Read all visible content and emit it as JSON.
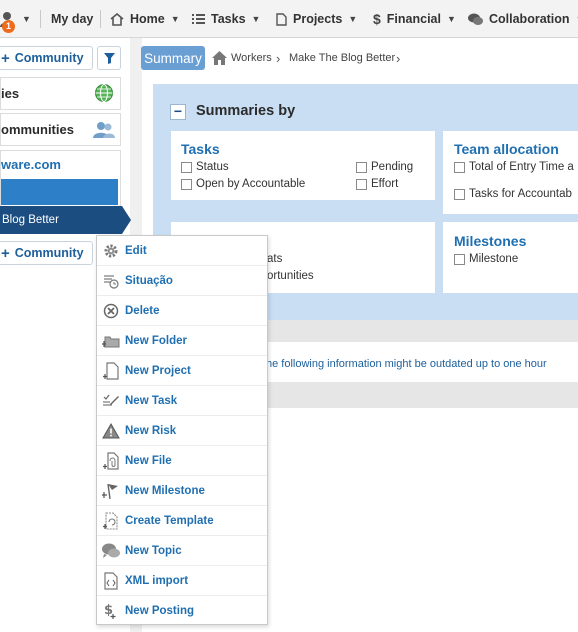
{
  "topnav": {
    "notification_count": "1",
    "my_day": "My day",
    "home": "Home",
    "tasks": "Tasks",
    "projects": "Projects",
    "financial": "Financial",
    "collaboration": "Collaboration"
  },
  "left_panel": {
    "community_button": "Community",
    "community_button_2": "Community",
    "box1": "ies",
    "box2": "ommunities",
    "group_title": "ware.com",
    "active_project": "Blog Better"
  },
  "breadcrumb": {
    "summary": "Summary",
    "workers": "Workers",
    "project": "Make The Blog Better"
  },
  "summaries": {
    "title": "Summaries by",
    "tasks_card": {
      "title": "Tasks",
      "items": [
        "Status",
        "Open by Accountable",
        "Pending",
        "Effort"
      ]
    },
    "team_card": {
      "title": "Team allocation",
      "items": [
        "Total of Entry Time a",
        "Tasks for Accountab"
      ]
    },
    "partial_card": {
      "items": [
        "ats",
        "ortunities"
      ]
    },
    "milestones_card": {
      "title": "Milestones",
      "items": [
        "Milestone"
      ]
    }
  },
  "info_text": "he following information might be outdated up to one hour",
  "context_menu": {
    "items": [
      {
        "label": "Edit",
        "icon": "gear-icon"
      },
      {
        "label": "Situação",
        "icon": "status-clock-icon"
      },
      {
        "label": "Delete",
        "icon": "delete-icon"
      },
      {
        "label": "New Folder",
        "icon": "new-folder-icon"
      },
      {
        "label": "New Project",
        "icon": "new-project-icon"
      },
      {
        "label": "New Task",
        "icon": "new-task-icon"
      },
      {
        "label": "New Risk",
        "icon": "risk-warning-icon"
      },
      {
        "label": "New File",
        "icon": "new-file-icon"
      },
      {
        "label": "New Milestone",
        "icon": "milestone-flag-icon"
      },
      {
        "label": "Create Template",
        "icon": "template-icon"
      },
      {
        "label": "New Topic",
        "icon": "topic-icon"
      },
      {
        "label": "XML import",
        "icon": "xml-import-icon"
      },
      {
        "label": "New Posting",
        "icon": "posting-icon"
      }
    ]
  },
  "colors": {
    "accent_blue": "#1f6fb1",
    "nav_active": "#1b4d80",
    "panel_bg": "#c9def2",
    "summary_tab": "#6a9fd4",
    "badge": "#f06a1b"
  }
}
